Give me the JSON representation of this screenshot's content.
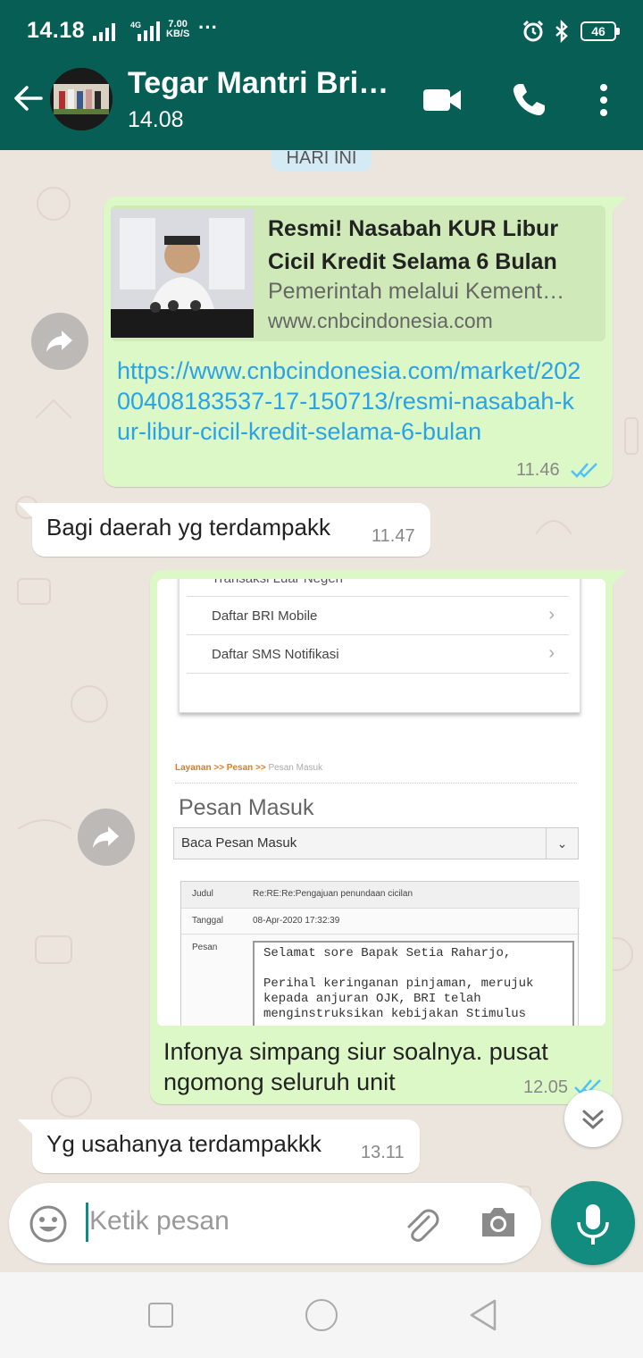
{
  "status_bar": {
    "time": "14.18",
    "network": "4G",
    "speed_value": "7.00",
    "speed_unit": "KB/S",
    "more": "···",
    "battery": "46"
  },
  "header": {
    "contact_name": "Tegar Mantri Bri…",
    "last_seen": "14.08"
  },
  "chat": {
    "date_chip": "HARI INI",
    "messages": [
      {
        "type": "link",
        "preview_title": "Resmi! Nasabah KUR Libur Cicil Kredit Selama 6 Bulan",
        "preview_desc": "Pemerintah melalui Kement…",
        "preview_domain": "www.cnbcindonesia.com",
        "link": "https://www.cnbcindonesia.com/market/20200408183537-17-150713/resmi-nasabah-kur-libur-cicil-kredit-selama-6-bulan",
        "time": "11.46"
      },
      {
        "type": "text",
        "text": "Bagi daerah yg terdampakk",
        "time": "11.47"
      },
      {
        "type": "image",
        "screenshot": {
          "menu_top": "Transaksi Luar Negeri",
          "menu_1": "Daftar BRI Mobile",
          "menu_2": "Daftar SMS Notifikasi",
          "breadcrumb_a": "Layanan >> Pesan >>",
          "breadcrumb_b": "Pesan Masuk",
          "heading": "Pesan Masuk",
          "select": "Baca Pesan Masuk",
          "judul_label": "Judul",
          "judul_value": "Re:RE:Re:Pengajuan penundaan cicilan",
          "tanggal_label": "Tanggal",
          "tanggal_value": "08-Apr-2020 17:32:39",
          "pesan_label": "Pesan",
          "pesan_line1": "Selamat sore Bapak Setia Raharjo,",
          "pesan_line2": "Perihal keringanan pinjaman, merujuk",
          "pesan_line3": "kepada anjuran OJK, BRI telah",
          "pesan_line4": "menginstruksikan kebijakan Stimulus"
        },
        "caption": "Infonya simpang siur soalnya.  pusat ngomong seluruh unit",
        "time": "12.05"
      },
      {
        "type": "text",
        "text": "Yg usahanya terdampakkk",
        "time": "13.11"
      }
    ]
  },
  "input": {
    "placeholder": "Ketik pesan"
  },
  "colors": {
    "header": "#075e54",
    "outgoing": "#dcf8c6",
    "accent": "#128c7e",
    "link": "#2aa2e6",
    "ticks": "#4fc3f7"
  }
}
